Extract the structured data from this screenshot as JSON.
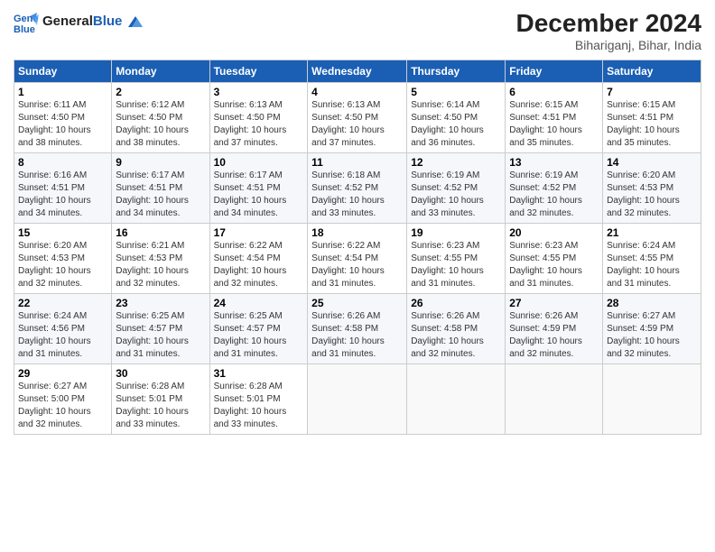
{
  "header": {
    "logo_line1": "General",
    "logo_line2": "Blue",
    "main_title": "December 2024",
    "subtitle": "Bihariganj, Bihar, India"
  },
  "weekdays": [
    "Sunday",
    "Monday",
    "Tuesday",
    "Wednesday",
    "Thursday",
    "Friday",
    "Saturday"
  ],
  "weeks": [
    [
      {
        "day": "1",
        "info": "Sunrise: 6:11 AM\nSunset: 4:50 PM\nDaylight: 10 hours\nand 38 minutes."
      },
      {
        "day": "2",
        "info": "Sunrise: 6:12 AM\nSunset: 4:50 PM\nDaylight: 10 hours\nand 38 minutes."
      },
      {
        "day": "3",
        "info": "Sunrise: 6:13 AM\nSunset: 4:50 PM\nDaylight: 10 hours\nand 37 minutes."
      },
      {
        "day": "4",
        "info": "Sunrise: 6:13 AM\nSunset: 4:50 PM\nDaylight: 10 hours\nand 37 minutes."
      },
      {
        "day": "5",
        "info": "Sunrise: 6:14 AM\nSunset: 4:50 PM\nDaylight: 10 hours\nand 36 minutes."
      },
      {
        "day": "6",
        "info": "Sunrise: 6:15 AM\nSunset: 4:51 PM\nDaylight: 10 hours\nand 35 minutes."
      },
      {
        "day": "7",
        "info": "Sunrise: 6:15 AM\nSunset: 4:51 PM\nDaylight: 10 hours\nand 35 minutes."
      }
    ],
    [
      {
        "day": "8",
        "info": "Sunrise: 6:16 AM\nSunset: 4:51 PM\nDaylight: 10 hours\nand 34 minutes."
      },
      {
        "day": "9",
        "info": "Sunrise: 6:17 AM\nSunset: 4:51 PM\nDaylight: 10 hours\nand 34 minutes."
      },
      {
        "day": "10",
        "info": "Sunrise: 6:17 AM\nSunset: 4:51 PM\nDaylight: 10 hours\nand 34 minutes."
      },
      {
        "day": "11",
        "info": "Sunrise: 6:18 AM\nSunset: 4:52 PM\nDaylight: 10 hours\nand 33 minutes."
      },
      {
        "day": "12",
        "info": "Sunrise: 6:19 AM\nSunset: 4:52 PM\nDaylight: 10 hours\nand 33 minutes."
      },
      {
        "day": "13",
        "info": "Sunrise: 6:19 AM\nSunset: 4:52 PM\nDaylight: 10 hours\nand 32 minutes."
      },
      {
        "day": "14",
        "info": "Sunrise: 6:20 AM\nSunset: 4:53 PM\nDaylight: 10 hours\nand 32 minutes."
      }
    ],
    [
      {
        "day": "15",
        "info": "Sunrise: 6:20 AM\nSunset: 4:53 PM\nDaylight: 10 hours\nand 32 minutes."
      },
      {
        "day": "16",
        "info": "Sunrise: 6:21 AM\nSunset: 4:53 PM\nDaylight: 10 hours\nand 32 minutes."
      },
      {
        "day": "17",
        "info": "Sunrise: 6:22 AM\nSunset: 4:54 PM\nDaylight: 10 hours\nand 32 minutes."
      },
      {
        "day": "18",
        "info": "Sunrise: 6:22 AM\nSunset: 4:54 PM\nDaylight: 10 hours\nand 31 minutes."
      },
      {
        "day": "19",
        "info": "Sunrise: 6:23 AM\nSunset: 4:55 PM\nDaylight: 10 hours\nand 31 minutes."
      },
      {
        "day": "20",
        "info": "Sunrise: 6:23 AM\nSunset: 4:55 PM\nDaylight: 10 hours\nand 31 minutes."
      },
      {
        "day": "21",
        "info": "Sunrise: 6:24 AM\nSunset: 4:55 PM\nDaylight: 10 hours\nand 31 minutes."
      }
    ],
    [
      {
        "day": "22",
        "info": "Sunrise: 6:24 AM\nSunset: 4:56 PM\nDaylight: 10 hours\nand 31 minutes."
      },
      {
        "day": "23",
        "info": "Sunrise: 6:25 AM\nSunset: 4:57 PM\nDaylight: 10 hours\nand 31 minutes."
      },
      {
        "day": "24",
        "info": "Sunrise: 6:25 AM\nSunset: 4:57 PM\nDaylight: 10 hours\nand 31 minutes."
      },
      {
        "day": "25",
        "info": "Sunrise: 6:26 AM\nSunset: 4:58 PM\nDaylight: 10 hours\nand 31 minutes."
      },
      {
        "day": "26",
        "info": "Sunrise: 6:26 AM\nSunset: 4:58 PM\nDaylight: 10 hours\nand 32 minutes."
      },
      {
        "day": "27",
        "info": "Sunrise: 6:26 AM\nSunset: 4:59 PM\nDaylight: 10 hours\nand 32 minutes."
      },
      {
        "day": "28",
        "info": "Sunrise: 6:27 AM\nSunset: 4:59 PM\nDaylight: 10 hours\nand 32 minutes."
      }
    ],
    [
      {
        "day": "29",
        "info": "Sunrise: 6:27 AM\nSunset: 5:00 PM\nDaylight: 10 hours\nand 32 minutes."
      },
      {
        "day": "30",
        "info": "Sunrise: 6:28 AM\nSunset: 5:01 PM\nDaylight: 10 hours\nand 33 minutes."
      },
      {
        "day": "31",
        "info": "Sunrise: 6:28 AM\nSunset: 5:01 PM\nDaylight: 10 hours\nand 33 minutes."
      },
      null,
      null,
      null,
      null
    ]
  ]
}
